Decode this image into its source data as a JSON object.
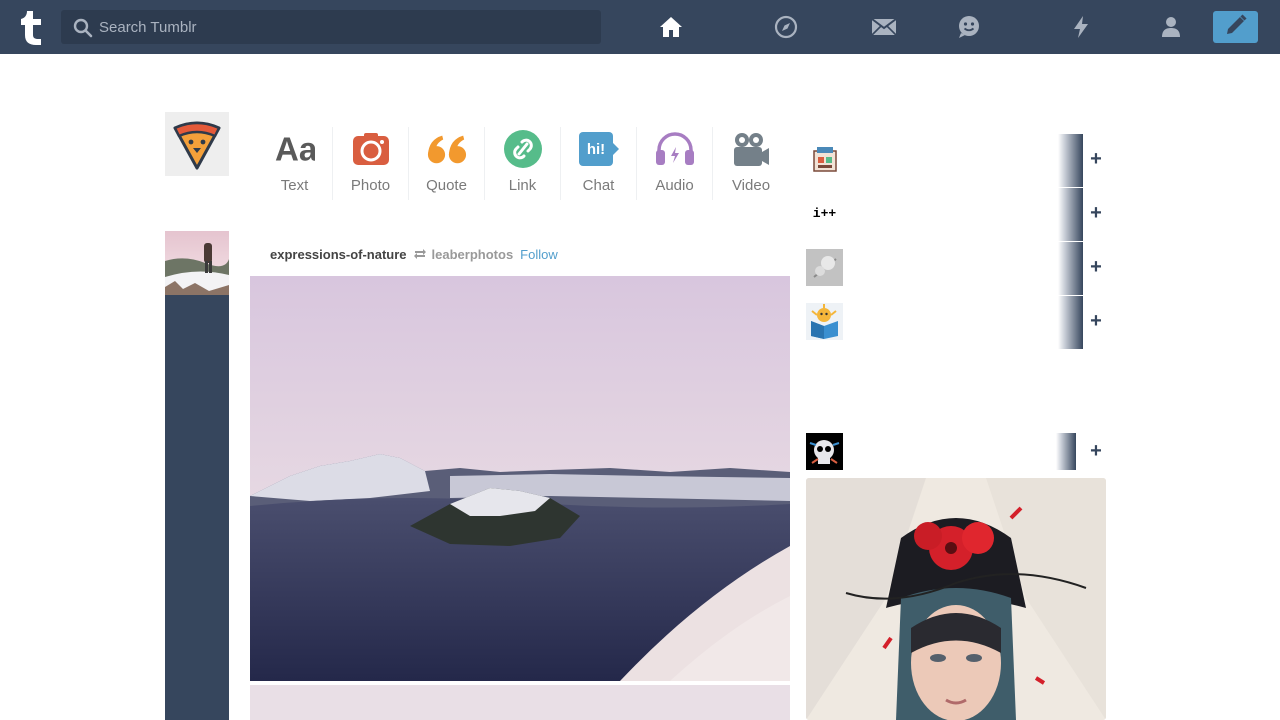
{
  "search": {
    "placeholder": "Search Tumblr"
  },
  "nav": {
    "icons": [
      "home-icon",
      "explore-icon",
      "inbox-icon",
      "messaging-icon",
      "activity-icon",
      "account-icon",
      "compose-icon"
    ],
    "active": "home"
  },
  "post_types": [
    {
      "label": "Text",
      "icon": "text-post-icon",
      "color": "#5a5a5a"
    },
    {
      "label": "Photo",
      "icon": "photo-post-icon",
      "color": "#d95e40"
    },
    {
      "label": "Quote",
      "icon": "quote-post-icon",
      "color": "#f2992e"
    },
    {
      "label": "Link",
      "icon": "link-post-icon",
      "color": "#56bc8a"
    },
    {
      "label": "Chat",
      "icon": "chat-post-icon",
      "color": "#529ecc"
    },
    {
      "label": "Audio",
      "icon": "audio-post-icon",
      "color": "#a77dc2"
    },
    {
      "label": "Video",
      "icon": "video-post-icon",
      "color": "#748089"
    }
  ],
  "post": {
    "author": "expressions-of-nature",
    "source": "leaberphotos",
    "follow_label": "Follow"
  },
  "sidebar": {
    "recommended": [
      {
        "avatar_text": "",
        "add_label": "+"
      },
      {
        "avatar_text": "i++",
        "add_label": "+"
      },
      {
        "avatar_text": "",
        "add_label": "+"
      },
      {
        "avatar_text": "",
        "add_label": "+"
      }
    ],
    "radar": {
      "add_label": "+"
    }
  },
  "colors": {
    "navbar": "#36465d",
    "accent": "#529ecc",
    "search_bg": "#2d3b4f"
  }
}
